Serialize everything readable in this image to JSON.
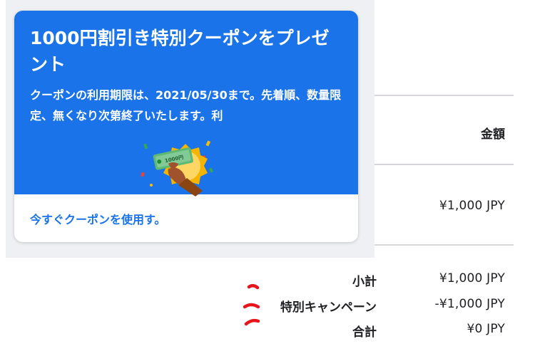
{
  "coupon": {
    "title": "1000円割引き特別クーポンをプレゼント",
    "description": "クーポンの利用期限は、2021/05/30まで。先着順、数量限定、無くなり次第終了いたします。利",
    "illustration_badge": "1000円",
    "link_label": "今すぐクーポンを使用す。"
  },
  "invoice": {
    "amount_header": "金額",
    "line_amount": "¥1,000 JPY",
    "summary": [
      {
        "label": "小計",
        "value": "¥1,000 JPY"
      },
      {
        "label": "特別キャンペーン",
        "value": "-¥1,000 JPY"
      },
      {
        "label": "合計",
        "value": "¥0 JPY"
      }
    ]
  },
  "colors": {
    "accent": "#1a73e8",
    "annotation": "#e8141c",
    "illustration_gold": "#f4b400"
  }
}
